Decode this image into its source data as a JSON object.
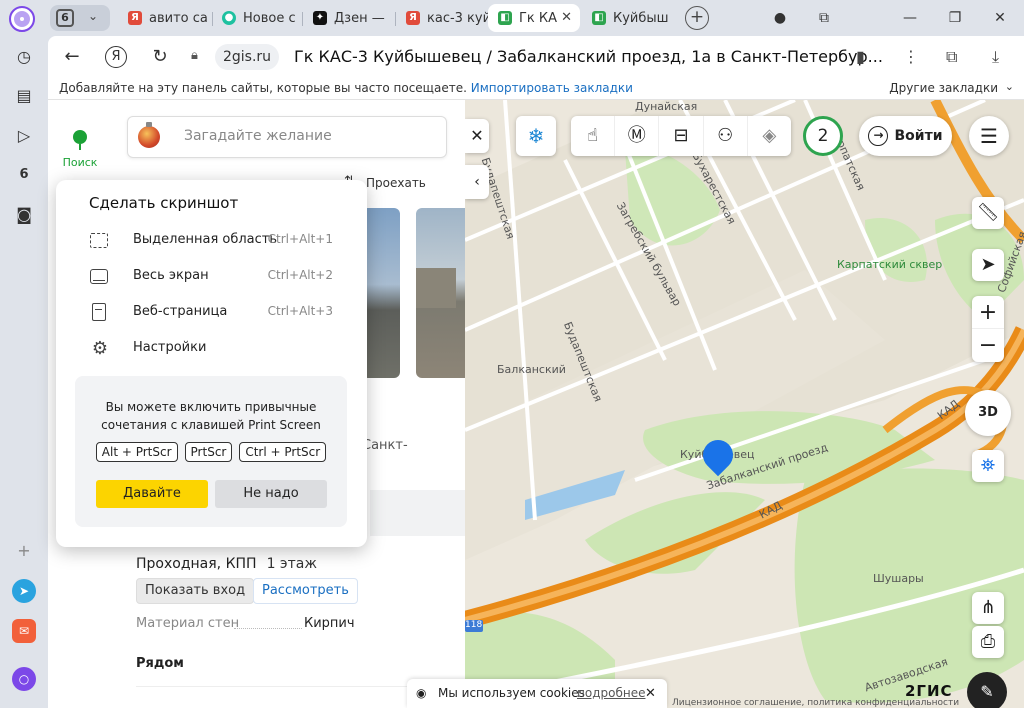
{
  "browser": {
    "tab_count": "6",
    "tabs": [
      {
        "label": "авито са",
        "favicon_color": "#e14b3b",
        "favicon_glyph": "Я"
      },
      {
        "label": "Новое с",
        "favicon_color": "#1ec1a0",
        "favicon_glyph": "●"
      },
      {
        "label": "Дзен —",
        "favicon_color": "#111111",
        "favicon_glyph": "✦"
      },
      {
        "label": "кас-3 куй",
        "favicon_color": "#e14b3b",
        "favicon_glyph": "Я"
      },
      {
        "label": "Гк КА",
        "favicon_color": "#2ea44f",
        "favicon_glyph": "◧",
        "active": true
      },
      {
        "label": "Куйбыш",
        "favicon_color": "#2ea44f",
        "favicon_glyph": "◧"
      }
    ],
    "domain": "2gis.ru",
    "page_title": "Гк КАС-3 Куйбышевец / Забалканский проезд, 1а в Санкт-Петербур...",
    "bookmarks_prompt": "Добавляйте на эту панель сайты, которые вы часто посещаете.",
    "bookmarks_import": "Импортировать закладки",
    "bookmarks_other": "Другие закладки"
  },
  "gis": {
    "nav_search_label": "Поиск",
    "search_placeholder": "Загадайте желание",
    "route_label": "Проехать",
    "address_fragment": "Санкт-",
    "entrance_label": "Проходная, КПП",
    "entrance_floor": "1 этаж",
    "show_entrance": "Показать вход",
    "view_button": "Рассмотреть",
    "wall_label": "Материал стен",
    "wall_value": "Кирпич",
    "nearby_heading": "Рядом"
  },
  "screenshot_menu": {
    "title": "Сделать скриншот",
    "items": [
      {
        "label": "Выделенная область",
        "hotkey": "Ctrl+Alt+1"
      },
      {
        "label": "Весь экран",
        "hotkey": "Ctrl+Alt+2"
      },
      {
        "label": "Веб-страница",
        "hotkey": "Ctrl+Alt+3"
      },
      {
        "label": "Настройки",
        "hotkey": ""
      }
    ],
    "tip": "Вы можете включить привычные сочетания с клавишей Print Screen",
    "keys": [
      "Alt + PrtScr",
      "PrtScr",
      "Ctrl + PrtScr"
    ],
    "accept": "Давайте",
    "decline": "Не надо"
  },
  "map": {
    "login_label": "Войти",
    "badge_count": "2",
    "btn_3d": "3D",
    "labels": {
      "pin_place": "Куйбышевец",
      "street_zabalkansky": "Забалканский проезд",
      "kad": "КАД",
      "kad2": "КАД",
      "budapeshtskaya": "Будапештская",
      "budapeshtskaya2": "Будапештская",
      "zagrebsky": "Загребский бульвар",
      "bukharestskaya": "Бухарестская",
      "karpatskaya": "Карпатская",
      "karpatsky_skver": "Карпатский сквер",
      "balkansky": "Балканский",
      "shushary": "Шушары",
      "dunayskaya": "Дунайская",
      "sofiyskaya": "Софийская",
      "avtozavodskaya": "Автозаводская",
      "route_118": "118"
    },
    "logo": "2ГИС",
    "licence": "Лицензионное соглашение, политика конфиденциальности",
    "cookie_text": "Мы используем cookies",
    "cookie_link": "подробнее"
  },
  "colors": {
    "accent_green": "#1ba136",
    "yandex_yellow": "#fcd400",
    "link_blue": "#1a6fc2",
    "kad_orange": "#e98b18"
  }
}
